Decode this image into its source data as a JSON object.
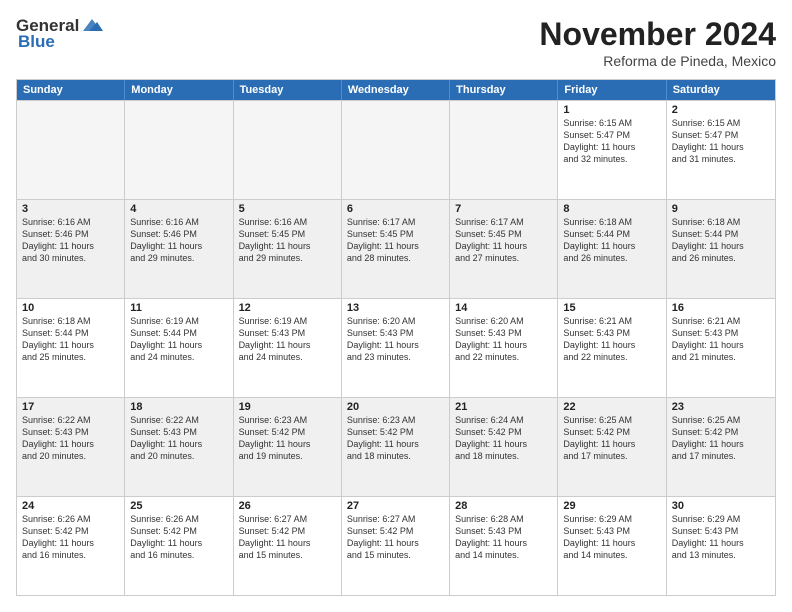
{
  "logo": {
    "general": "General",
    "blue": "Blue"
  },
  "title": "November 2024",
  "location": "Reforma de Pineda, Mexico",
  "days": [
    "Sunday",
    "Monday",
    "Tuesday",
    "Wednesday",
    "Thursday",
    "Friday",
    "Saturday"
  ],
  "weeks": [
    [
      {
        "day": "",
        "info": ""
      },
      {
        "day": "",
        "info": ""
      },
      {
        "day": "",
        "info": ""
      },
      {
        "day": "",
        "info": ""
      },
      {
        "day": "",
        "info": ""
      },
      {
        "day": "1",
        "info": "Sunrise: 6:15 AM\nSunset: 5:47 PM\nDaylight: 11 hours\nand 32 minutes."
      },
      {
        "day": "2",
        "info": "Sunrise: 6:15 AM\nSunset: 5:47 PM\nDaylight: 11 hours\nand 31 minutes."
      }
    ],
    [
      {
        "day": "3",
        "info": "Sunrise: 6:16 AM\nSunset: 5:46 PM\nDaylight: 11 hours\nand 30 minutes."
      },
      {
        "day": "4",
        "info": "Sunrise: 6:16 AM\nSunset: 5:46 PM\nDaylight: 11 hours\nand 29 minutes."
      },
      {
        "day": "5",
        "info": "Sunrise: 6:16 AM\nSunset: 5:45 PM\nDaylight: 11 hours\nand 29 minutes."
      },
      {
        "day": "6",
        "info": "Sunrise: 6:17 AM\nSunset: 5:45 PM\nDaylight: 11 hours\nand 28 minutes."
      },
      {
        "day": "7",
        "info": "Sunrise: 6:17 AM\nSunset: 5:45 PM\nDaylight: 11 hours\nand 27 minutes."
      },
      {
        "day": "8",
        "info": "Sunrise: 6:18 AM\nSunset: 5:44 PM\nDaylight: 11 hours\nand 26 minutes."
      },
      {
        "day": "9",
        "info": "Sunrise: 6:18 AM\nSunset: 5:44 PM\nDaylight: 11 hours\nand 26 minutes."
      }
    ],
    [
      {
        "day": "10",
        "info": "Sunrise: 6:18 AM\nSunset: 5:44 PM\nDaylight: 11 hours\nand 25 minutes."
      },
      {
        "day": "11",
        "info": "Sunrise: 6:19 AM\nSunset: 5:44 PM\nDaylight: 11 hours\nand 24 minutes."
      },
      {
        "day": "12",
        "info": "Sunrise: 6:19 AM\nSunset: 5:43 PM\nDaylight: 11 hours\nand 24 minutes."
      },
      {
        "day": "13",
        "info": "Sunrise: 6:20 AM\nSunset: 5:43 PM\nDaylight: 11 hours\nand 23 minutes."
      },
      {
        "day": "14",
        "info": "Sunrise: 6:20 AM\nSunset: 5:43 PM\nDaylight: 11 hours\nand 22 minutes."
      },
      {
        "day": "15",
        "info": "Sunrise: 6:21 AM\nSunset: 5:43 PM\nDaylight: 11 hours\nand 22 minutes."
      },
      {
        "day": "16",
        "info": "Sunrise: 6:21 AM\nSunset: 5:43 PM\nDaylight: 11 hours\nand 21 minutes."
      }
    ],
    [
      {
        "day": "17",
        "info": "Sunrise: 6:22 AM\nSunset: 5:43 PM\nDaylight: 11 hours\nand 20 minutes."
      },
      {
        "day": "18",
        "info": "Sunrise: 6:22 AM\nSunset: 5:43 PM\nDaylight: 11 hours\nand 20 minutes."
      },
      {
        "day": "19",
        "info": "Sunrise: 6:23 AM\nSunset: 5:42 PM\nDaylight: 11 hours\nand 19 minutes."
      },
      {
        "day": "20",
        "info": "Sunrise: 6:23 AM\nSunset: 5:42 PM\nDaylight: 11 hours\nand 18 minutes."
      },
      {
        "day": "21",
        "info": "Sunrise: 6:24 AM\nSunset: 5:42 PM\nDaylight: 11 hours\nand 18 minutes."
      },
      {
        "day": "22",
        "info": "Sunrise: 6:25 AM\nSunset: 5:42 PM\nDaylight: 11 hours\nand 17 minutes."
      },
      {
        "day": "23",
        "info": "Sunrise: 6:25 AM\nSunset: 5:42 PM\nDaylight: 11 hours\nand 17 minutes."
      }
    ],
    [
      {
        "day": "24",
        "info": "Sunrise: 6:26 AM\nSunset: 5:42 PM\nDaylight: 11 hours\nand 16 minutes."
      },
      {
        "day": "25",
        "info": "Sunrise: 6:26 AM\nSunset: 5:42 PM\nDaylight: 11 hours\nand 16 minutes."
      },
      {
        "day": "26",
        "info": "Sunrise: 6:27 AM\nSunset: 5:42 PM\nDaylight: 11 hours\nand 15 minutes."
      },
      {
        "day": "27",
        "info": "Sunrise: 6:27 AM\nSunset: 5:42 PM\nDaylight: 11 hours\nand 15 minutes."
      },
      {
        "day": "28",
        "info": "Sunrise: 6:28 AM\nSunset: 5:43 PM\nDaylight: 11 hours\nand 14 minutes."
      },
      {
        "day": "29",
        "info": "Sunrise: 6:29 AM\nSunset: 5:43 PM\nDaylight: 11 hours\nand 14 minutes."
      },
      {
        "day": "30",
        "info": "Sunrise: 6:29 AM\nSunset: 5:43 PM\nDaylight: 11 hours\nand 13 minutes."
      }
    ]
  ]
}
